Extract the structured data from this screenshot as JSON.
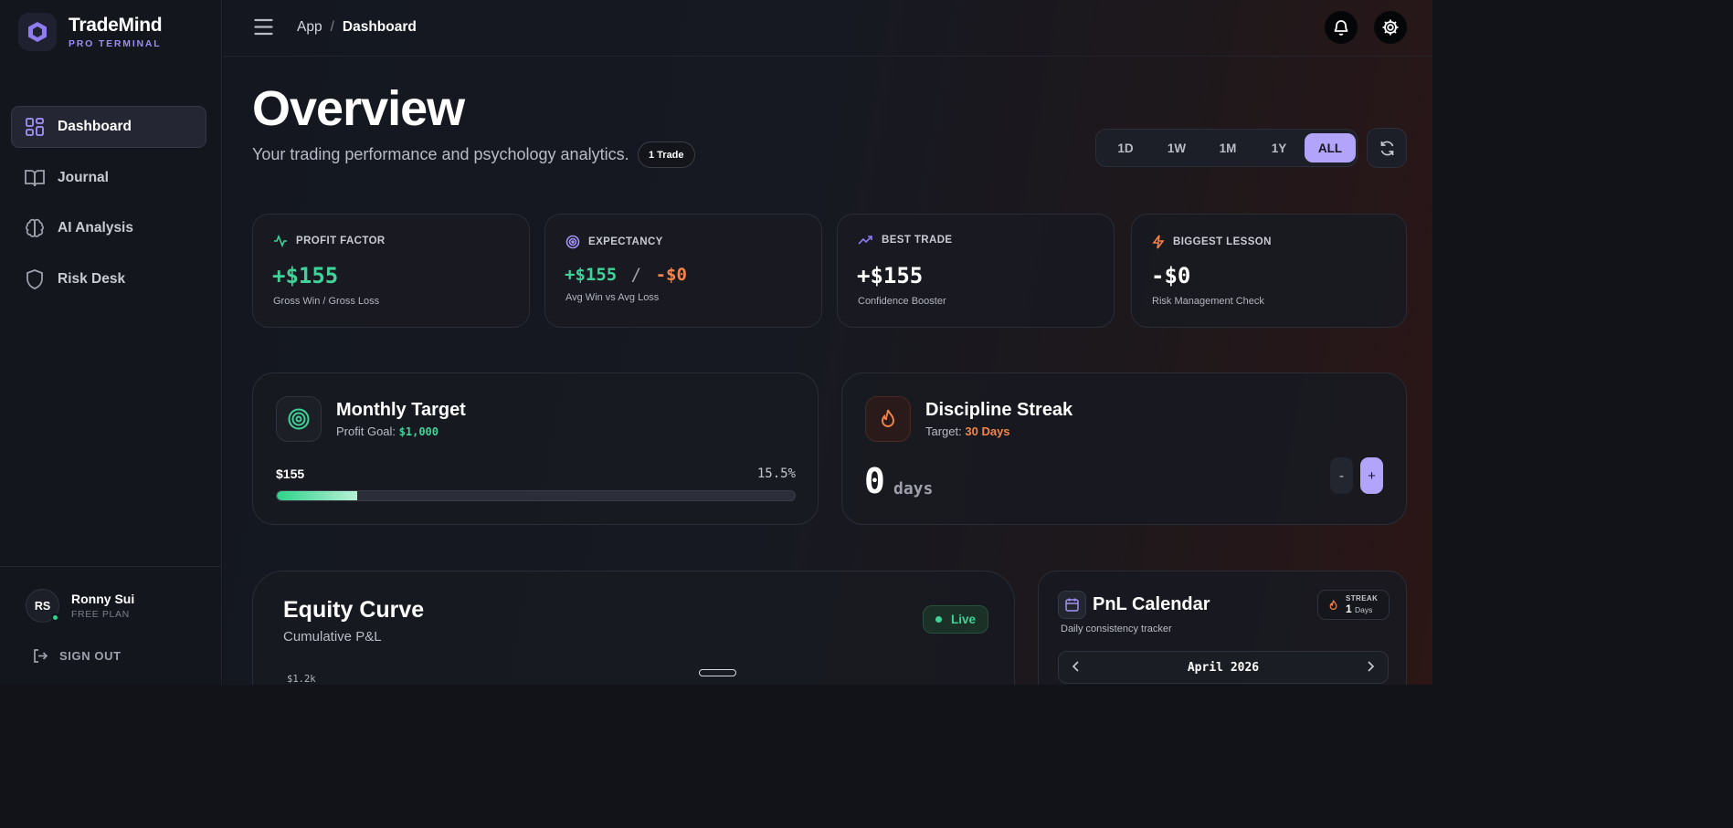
{
  "brand": {
    "name": "TradeMind",
    "subtitle": "PRO TERMINAL"
  },
  "sidebar": {
    "items": [
      {
        "label": "Dashboard",
        "icon": "grid-icon",
        "active": true
      },
      {
        "label": "Journal",
        "icon": "book-icon",
        "active": false
      },
      {
        "label": "AI Analysis",
        "icon": "brain-icon",
        "active": false
      },
      {
        "label": "Risk Desk",
        "icon": "shield-icon",
        "active": false
      }
    ],
    "user": {
      "initials": "RS",
      "name": "Ronny Sui",
      "plan": "FREE PLAN",
      "status": "online"
    },
    "signout": "SIGN OUT"
  },
  "header": {
    "breadcrumb_root": "App",
    "breadcrumb_sep": "/",
    "breadcrumb_current": "Dashboard"
  },
  "page": {
    "title": "Overview",
    "subtitle": "Your trading performance and psychology analytics.",
    "trade_badge": "1 Trade"
  },
  "range": {
    "options": [
      "1D",
      "1W",
      "1M",
      "1Y",
      "ALL"
    ],
    "selected": "ALL"
  },
  "stats": [
    {
      "label": "PROFIT FACTOR",
      "icon": "pulse-icon",
      "value": "+$155",
      "sub": "Gross Win / Gross Loss"
    },
    {
      "label": "EXPECTANCY",
      "icon": "target-icon",
      "value_win": "+$155",
      "value_sep": "/",
      "value_loss": "-$0",
      "sub": "Avg Win vs Avg Loss"
    },
    {
      "label": "BEST TRADE",
      "icon": "trending-up-icon",
      "value": "+$155",
      "sub": "Confidence Booster"
    },
    {
      "label": "BIGGEST LESSON",
      "icon": "lightning-icon",
      "value": "-$0",
      "sub": "Risk Management Check"
    }
  ],
  "monthly_target": {
    "title": "Monthly Target",
    "goal_label": "Profit Goal:",
    "goal_value": "$1,000",
    "current": "$155",
    "percent_text": "15.5%",
    "progress": 0.155
  },
  "discipline": {
    "title": "Discipline Streak",
    "target_label": "Target:",
    "target_value": "30 Days",
    "count": "0",
    "unit": "days",
    "minus": "-",
    "plus": "+"
  },
  "equity": {
    "title": "Equity Curve",
    "subtitle": "Cumulative P&L",
    "live": "Live",
    "y_tick": "$1.2k"
  },
  "calendar": {
    "title": "PnL Calendar",
    "subtitle": "Daily consistency tracker",
    "streak_label": "STREAK",
    "streak_value": "1",
    "streak_unit": "Days",
    "month": "April 2026"
  },
  "colors": {
    "accent": "#b3a4fb",
    "profit": "#3fd39a",
    "loss": "#f4844a"
  }
}
